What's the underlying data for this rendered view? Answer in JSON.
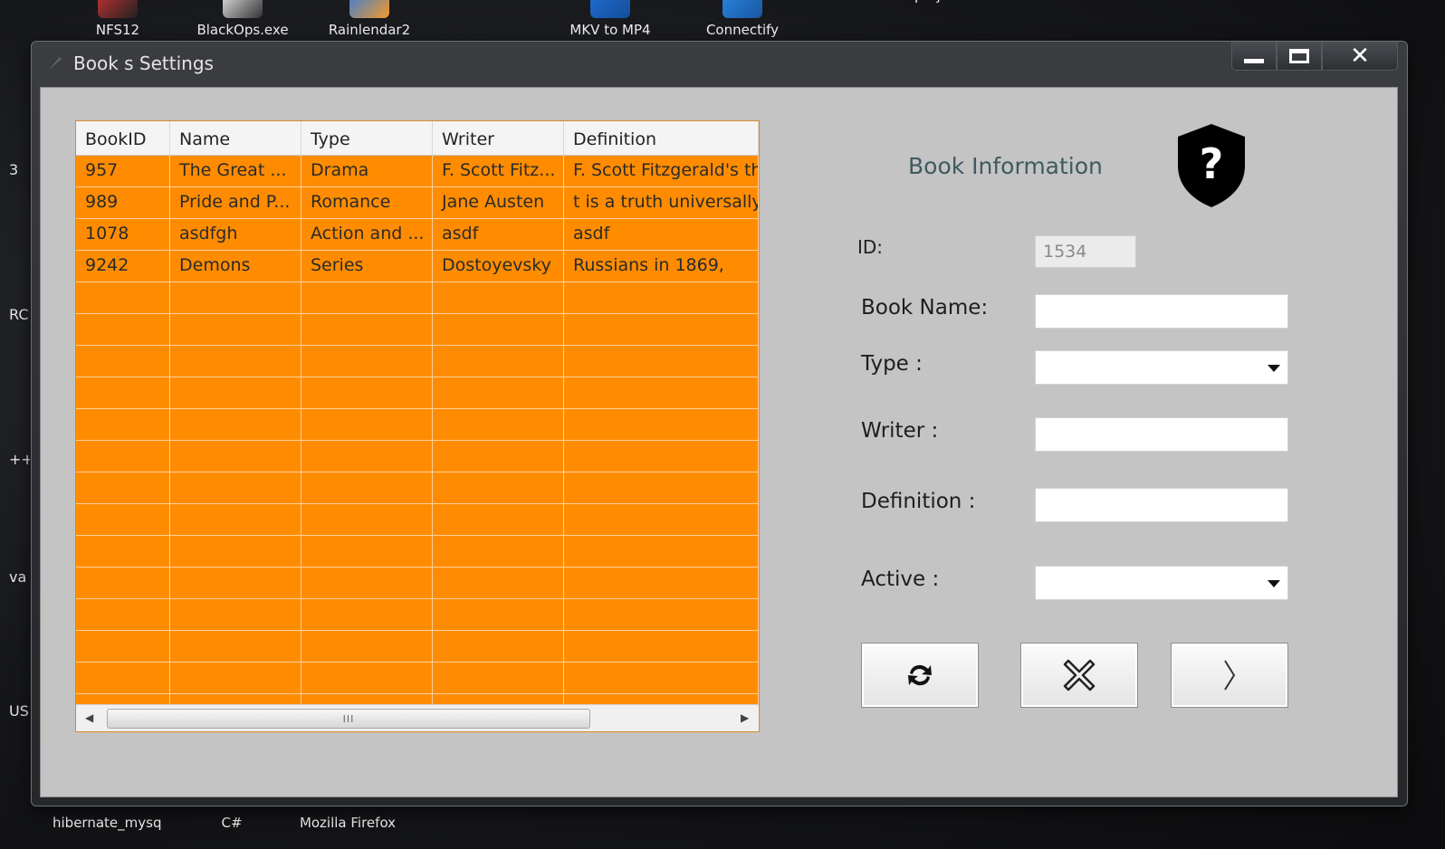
{
  "desktop": {
    "top_icons": [
      "NFS12",
      "BlackOps.exe",
      "Rainlendar2",
      "MKV to MP4",
      "Connectify",
      "projects"
    ],
    "bottom_icons": [
      "hibernate_mysql",
      "C#",
      "Mozilla Firefox",
      "",
      ""
    ],
    "left_labels": [
      "3",
      "RC",
      "++",
      "va",
      "US"
    ]
  },
  "window": {
    "title": "Book s Settings",
    "buttons": {
      "minimize": "minimize",
      "maximize": "maximize",
      "close": "close"
    }
  },
  "table": {
    "columns": [
      "BookID",
      "Name",
      "Type",
      "Writer",
      "Definition"
    ],
    "rows": [
      [
        "957",
        "The Great ...",
        "Drama",
        "F. Scott Fitz...",
        "F. Scott Fitzgerald's th"
      ],
      [
        "989",
        "Pride and P...",
        "Romance",
        "Jane Austen",
        "t is a truth universally"
      ],
      [
        "1078",
        "asdfgh",
        "Action and ...",
        "asdf",
        "asdf"
      ],
      [
        "9242",
        "Demons",
        "Series",
        "Dostoyevsky",
        "Russians in 1869,"
      ]
    ],
    "empty_rows": 14,
    "scroll_grip": "III"
  },
  "form": {
    "title": "Book Information",
    "id_label": "ID:",
    "id_value": "1534",
    "name_label": "Book Name:",
    "type_label": "Type :",
    "writer_label": "Writer :",
    "definition_label": "Definition :",
    "active_label": "Active :"
  },
  "colors": {
    "table_bg": "#ff8c00",
    "client_bg": "#c4c4c4",
    "title_text": "#3f5a60"
  },
  "icons": {
    "shield": "shield-question-icon",
    "refresh": "refresh-icon",
    "delete": "x-circle-icon",
    "next": "chevron-right-icon"
  }
}
